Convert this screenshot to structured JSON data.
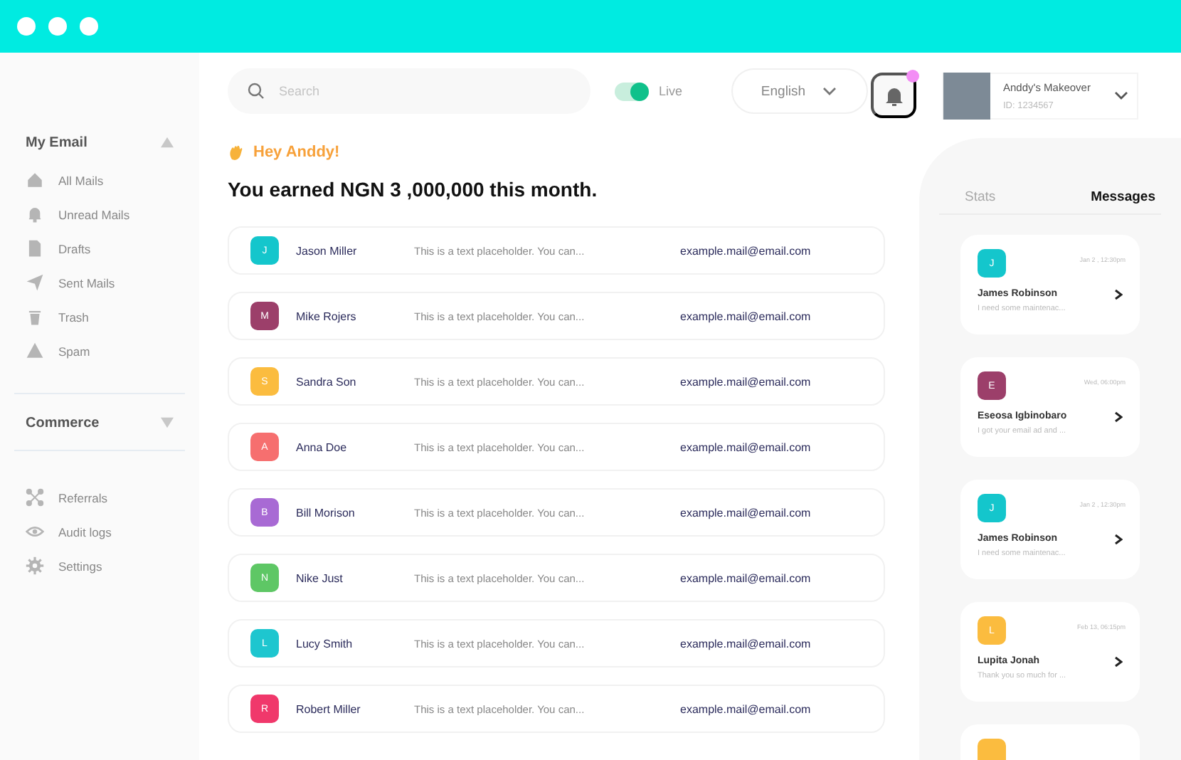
{
  "search": {
    "placeholder": "Search"
  },
  "live": {
    "label": "Live",
    "on": true
  },
  "language": {
    "value": "English"
  },
  "notifications": {
    "unread": true
  },
  "profile": {
    "name": "Anddy's Makeover",
    "id": "ID: 1234567"
  },
  "greeting": "Hey Anddy!",
  "headline": "You earned NGN 3 ,000,000 this month.",
  "sidebar": {
    "sections": [
      {
        "title": "My Email",
        "expanded": true,
        "items": [
          {
            "label": "All Mails"
          },
          {
            "label": "Unread Mails"
          },
          {
            "label": "Drafts"
          },
          {
            "label": "Sent Mails"
          },
          {
            "label": "Trash"
          },
          {
            "label": "Spam"
          }
        ]
      },
      {
        "title": "Commerce",
        "expanded": false
      }
    ],
    "footer_items": [
      {
        "label": "Referrals"
      },
      {
        "label": "Audit logs"
      },
      {
        "label": "Settings"
      }
    ]
  },
  "mails": [
    {
      "initial": "J",
      "color": "#14c6cc",
      "name": "Jason Miller",
      "preview": "This is a text placeholder. You can...",
      "email": "example.mail@email.com"
    },
    {
      "initial": "M",
      "color": "#9c3f6a",
      "name": "Mike Rojers",
      "preview": "This is a text placeholder. You can...",
      "email": "example.mail@email.com"
    },
    {
      "initial": "S",
      "color": "#fbbc3f",
      "name": "Sandra Son",
      "preview": "This is a text placeholder. You can...",
      "email": "example.mail@email.com"
    },
    {
      "initial": "A",
      "color": "#f66f6f",
      "name": "Anna Doe",
      "preview": "This is a text placeholder. You can...",
      "email": "example.mail@email.com"
    },
    {
      "initial": "B",
      "color": "#a86ad4",
      "name": "Bill Morison",
      "preview": "This is a text placeholder. You can...",
      "email": "example.mail@email.com"
    },
    {
      "initial": "N",
      "color": "#5ec765",
      "name": "Nike Just",
      "preview": "This is a text placeholder. You can...",
      "email": "example.mail@email.com"
    },
    {
      "initial": "L",
      "color": "#1ec6cf",
      "name": "Lucy Smith",
      "preview": "This is a text placeholder. You can...",
      "email": "example.mail@email.com"
    },
    {
      "initial": "R",
      "color": "#f0386b",
      "name": "Robert Miller",
      "preview": "This is a text placeholder. You can...",
      "email": "example.mail@email.com"
    }
  ],
  "panel_tabs": [
    {
      "label": "Stats",
      "selected": false
    },
    {
      "label": "Messages",
      "selected": true
    }
  ],
  "messages": [
    {
      "initial": "J",
      "color": "#14c6cc",
      "time": "Jan 2 , 12:30pm",
      "name": "James Robinson",
      "snippet": "I need some maintenac..."
    },
    {
      "initial": "E",
      "color": "#9c3f6a",
      "time": "Wed, 06:00pm",
      "name": "Eseosa Igbinobaro",
      "snippet": "I got your email ad and ..."
    },
    {
      "initial": "J",
      "color": "#14c6cc",
      "time": "Jan 2 , 12:30pm",
      "name": "James Robinson",
      "snippet": "I need some maintenac..."
    },
    {
      "initial": "L",
      "color": "#fbbc3f",
      "time": "Feb 13, 06:15pm",
      "name": "Lupita Jonah",
      "snippet": "Thank you so much for ..."
    },
    {
      "color": "#fbbc3f"
    }
  ]
}
